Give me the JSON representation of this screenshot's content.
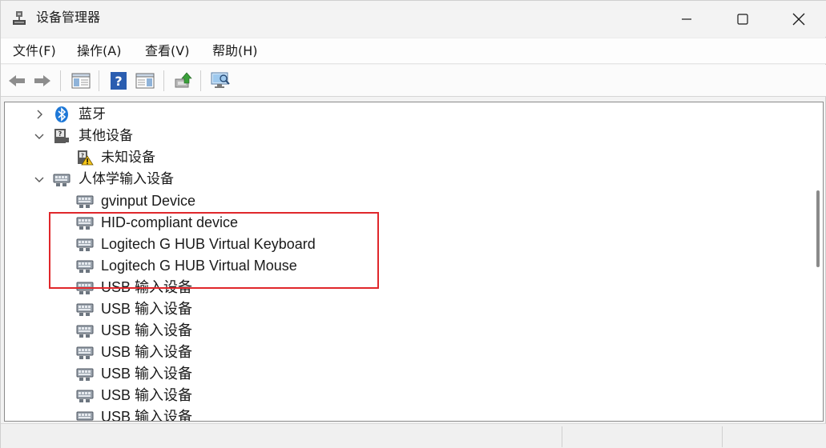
{
  "window": {
    "title": "设备管理器",
    "min_label": "",
    "max_label": "",
    "close_label": ""
  },
  "menu": {
    "items": [
      "文件(F)",
      "操作(A)",
      "查看(V)",
      "帮助(H)"
    ]
  },
  "toolbar": {
    "buttons": [
      "back-icon",
      "forward-icon",
      "console-tree-icon",
      "help-icon",
      "properties-panel-icon",
      "update-driver-icon",
      "scan-hardware-icon"
    ]
  },
  "tree": {
    "nodes": [
      {
        "label": "蓝牙",
        "expander": "collapsed",
        "icon": "bluetooth-icon",
        "level": 1
      },
      {
        "label": "其他设备",
        "expander": "expanded",
        "icon": "other-devices-icon",
        "level": 1
      },
      {
        "label": "未知设备",
        "expander": "none",
        "icon": "unknown-device-warning-icon",
        "level": 2
      },
      {
        "label": "人体学输入设备",
        "expander": "expanded",
        "icon": "hid-icon",
        "level": 1
      },
      {
        "label": "gvinput Device",
        "expander": "none",
        "icon": "hid-icon",
        "level": 2
      },
      {
        "label": "HID-compliant device",
        "expander": "none",
        "icon": "hid-icon",
        "level": 2
      },
      {
        "label": "Logitech G HUB Virtual Keyboard",
        "expander": "none",
        "icon": "hid-icon",
        "level": 2
      },
      {
        "label": "Logitech G HUB Virtual Mouse",
        "expander": "none",
        "icon": "hid-icon",
        "level": 2
      },
      {
        "label": "USB 输入设备",
        "expander": "none",
        "icon": "hid-icon",
        "level": 2
      },
      {
        "label": "USB 输入设备",
        "expander": "none",
        "icon": "hid-icon",
        "level": 2
      },
      {
        "label": "USB 输入设备",
        "expander": "none",
        "icon": "hid-icon",
        "level": 2
      },
      {
        "label": "USB 输入设备",
        "expander": "none",
        "icon": "hid-icon",
        "level": 2
      },
      {
        "label": "USB 输入设备",
        "expander": "none",
        "icon": "hid-icon",
        "level": 2
      },
      {
        "label": "USB 输入设备",
        "expander": "none",
        "icon": "hid-icon",
        "level": 2
      },
      {
        "label": "USB 输入设备",
        "expander": "none",
        "icon": "hid-icon",
        "level": 2
      }
    ]
  },
  "colors": {
    "highlight_border": "#e0272b",
    "help_blue": "#2a5db0",
    "bluetooth_blue": "#1e78d7"
  }
}
